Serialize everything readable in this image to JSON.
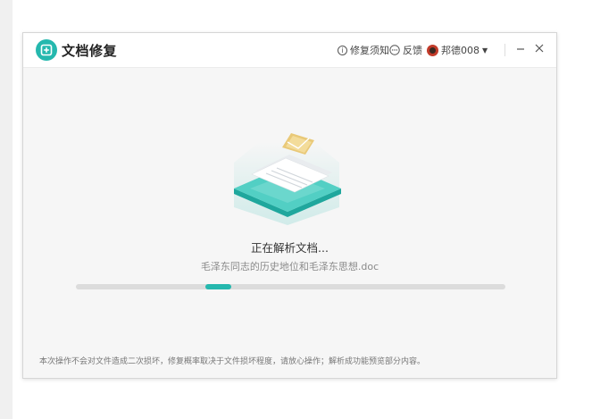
{
  "app": {
    "title": "文档修复",
    "accent_color": "#25b8ae"
  },
  "header": {
    "notice_label": "修复须知",
    "notice_icon": "info-circle-icon",
    "feedback_label": "反馈",
    "feedback_icon": "chat-bubble-icon",
    "user_name": "邦德008",
    "user_menu_icon": "caret-down-icon",
    "minimize_icon": "minimize-icon",
    "close_icon": "close-icon"
  },
  "main": {
    "status_text": "正在解析文档...",
    "file_name": "毛泽东同志的历史地位和毛泽东思想.doc",
    "progress_fraction": 0.33
  },
  "footer": {
    "note": "本次操作不会对文件造成二次损坏，修复概率取决于文件损坏程度，请放心操作；解析成功能预览部分内容。"
  }
}
